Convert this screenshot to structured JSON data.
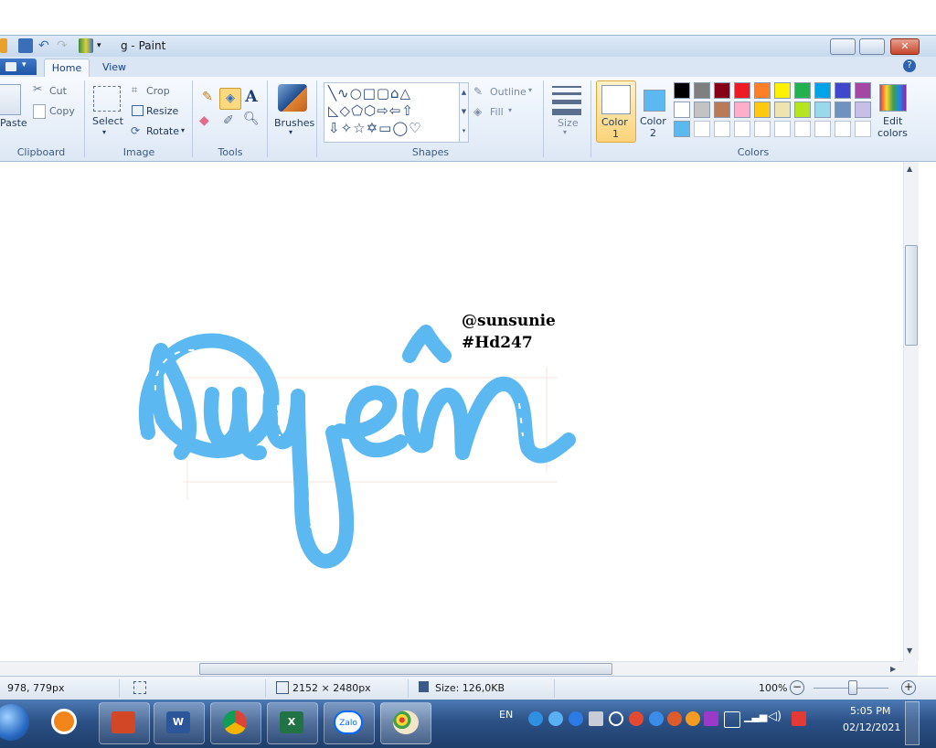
{
  "window": {
    "title": "g - Paint"
  },
  "tabs": [
    {
      "label": "Home"
    },
    {
      "label": "View"
    }
  ],
  "ribbon": {
    "clipboard": {
      "paste": "Paste",
      "cut": "Cut",
      "copy": "Copy",
      "label": "Clipboard"
    },
    "image": {
      "select": "Select",
      "crop": "Crop",
      "resize": "Resize",
      "rotate": "Rotate",
      "label": "Image"
    },
    "tools": {
      "label": "Tools"
    },
    "brushes": {
      "label": "Brushes"
    },
    "shapes": {
      "outline": "Outline",
      "fill": "Fill",
      "label": "Shapes"
    },
    "size": {
      "label": "Size"
    },
    "colors": {
      "color1": {
        "label": "Color",
        "num": "1",
        "value": "#ffffff"
      },
      "color2": {
        "label": "Color",
        "num": "2",
        "value": "#5bb8f0"
      },
      "edit": "Edit",
      "edit2": "colors",
      "label": "Colors",
      "palette_row1": [
        "#000000",
        "#7f7f7f",
        "#880015",
        "#ed1c24",
        "#ff7f27",
        "#fff200",
        "#22b14c",
        "#00a2e8",
        "#3f48cc",
        "#a349a4"
      ],
      "palette_row2": [
        "#ffffff",
        "#c3c3c3",
        "#b97a57",
        "#ffaec9",
        "#ffc90e",
        "#efe4b0",
        "#b5e61d",
        "#99d9ea",
        "#7092be",
        "#c8bfe7"
      ],
      "palette_row3": [
        "#5bb8f0"
      ]
    }
  },
  "canvas": {
    "handle": "@sunsunie",
    "tag": "#Hd247",
    "lettering": "Quyên",
    "lettering_color": "#5bb8f0"
  },
  "status": {
    "cursor": "978, 779px",
    "dimensions": "2152 × 2480px",
    "size": "Size: 126,0KB",
    "zoom": "100%",
    "zoom_out": "−",
    "zoom_in": "+"
  },
  "taskbar": {
    "apps": [
      "start",
      "media",
      "powerpoint",
      "word",
      "chrome",
      "excel",
      "zalo",
      "paint"
    ],
    "zalo": "Zalo",
    "lang": "EN",
    "time": "5:05 PM",
    "date": "02/12/2021"
  }
}
